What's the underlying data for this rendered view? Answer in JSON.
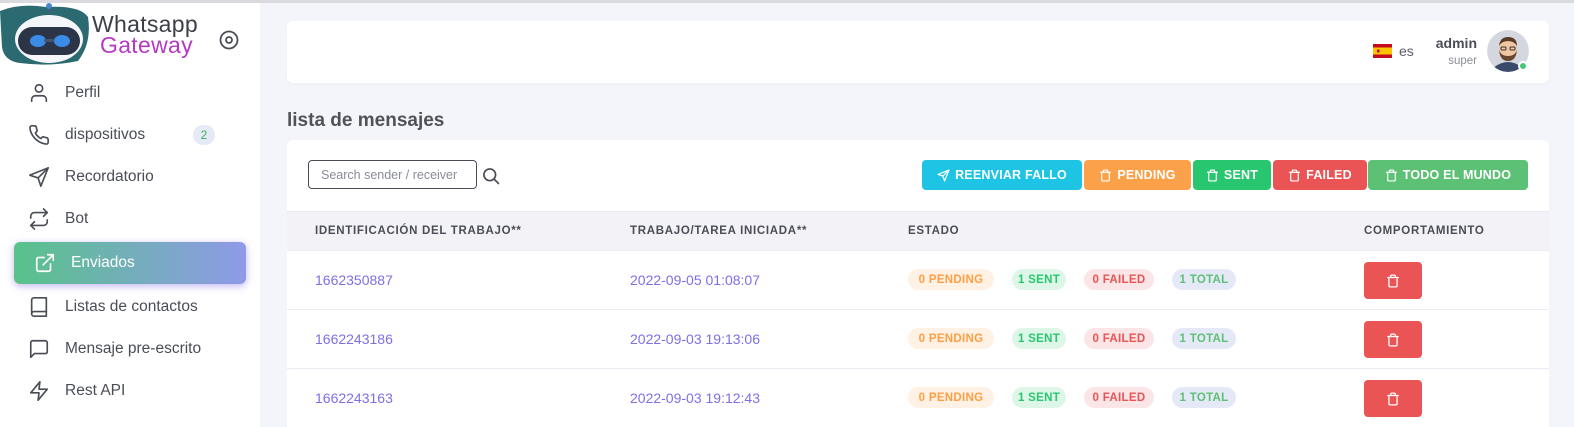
{
  "brand": {
    "line1": "Whatsapp",
    "line2": "Gateway"
  },
  "colors": {
    "brand_purple": "#b43bc1",
    "link": "#7d70e6",
    "cyan": "#1ec4e4",
    "orange": "#fba14a",
    "green": "#28c76f",
    "red": "#ea5455",
    "all_green": "#5dc175"
  },
  "sidebar": {
    "items": [
      {
        "label": "Perfil",
        "icon": "user-icon"
      },
      {
        "label": "dispositivos",
        "icon": "phone-icon",
        "badge": "2"
      },
      {
        "label": "Recordatorio",
        "icon": "send-icon"
      },
      {
        "label": "Bot",
        "icon": "repeat-icon"
      },
      {
        "label": "Enviados",
        "icon": "external-link-icon",
        "active": true
      },
      {
        "label": "Listas de contactos",
        "icon": "book-icon"
      },
      {
        "label": "Mensaje pre-escrito",
        "icon": "message-square-icon"
      },
      {
        "label": "Rest API",
        "icon": "zap-icon"
      }
    ]
  },
  "header": {
    "lang": "es",
    "user_name": "admin",
    "user_role": "super"
  },
  "page_title": "lista de mensajes",
  "search": {
    "placeholder": "Search sender / receiver"
  },
  "buttons": {
    "resend": "REENVIAR FALLO",
    "pending": "PENDING",
    "sent": "SENT",
    "failed": "FAILED",
    "all": "TODO EL MUNDO"
  },
  "table": {
    "headers": [
      "IDENTIFICACIÓN DEL TRABAJO**",
      "TRABAJO/TAREA INICIADA**",
      "ESTADO",
      "COMPORTAMIENTO"
    ],
    "rows": [
      {
        "id": "1662350887",
        "started": "2022-09-05 01:08:07",
        "pending": "0 PENDING",
        "sent": "1 SENT",
        "failed": "0 FAILED",
        "total": "1 TOTAL"
      },
      {
        "id": "1662243186",
        "started": "2022-09-03 19:13:06",
        "pending": "0 PENDING",
        "sent": "1 SENT",
        "failed": "0 FAILED",
        "total": "1 TOTAL"
      },
      {
        "id": "1662243163",
        "started": "2022-09-03 19:12:43",
        "pending": "0 PENDING",
        "sent": "1 SENT",
        "failed": "0 FAILED",
        "total": "1 TOTAL"
      }
    ]
  }
}
